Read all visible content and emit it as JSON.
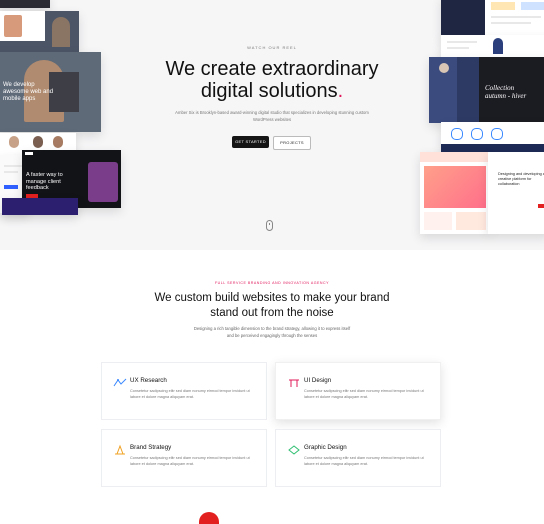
{
  "hero": {
    "eyebrow": "WATCH OUR REEL",
    "headline_line1": "We create extraordinary",
    "headline_line2": "digital solutions",
    "headline_dot": ".",
    "subtext": "Amber Six is Brooklyn-based award-winning digital studio that specializes in developing stunning custom WordPress websites",
    "primary_button": "GET STARTED",
    "secondary_button": "PROJECTS",
    "accent_color": "#e0185a"
  },
  "mockups": {
    "web_apps": "We develop awesome web and mobile apps",
    "client_feedback": "A faster way to manage client feedback",
    "collection": "Collection autumn - hiver",
    "collab": "Designing and developing a creative platform for collaboration"
  },
  "services": {
    "eyebrow": "FULL SERVICE BRANDING AND INNOVATION AGENCY",
    "title_line1": "We custom build websites to make your brand",
    "title_line2": "stand out from the noise",
    "subtitle": "Designing a rich tangible dimension to the brand strategy, allowing it to express itself and be perceived engagingly through the senses",
    "cards": [
      {
        "title": "UX Research",
        "icon": "ux-research-icon",
        "desc": "Consetetur sadipscing elitr sed diam nonumy eirmod tempor invidunt ut labore et dolore magna aliquyam erat."
      },
      {
        "title": "UI Design",
        "icon": "ui-design-icon",
        "desc": "Consetetur sadipscing elitr sed diam nonumy eirmod tempor invidunt ut labore et dolore magna aliquyam erat."
      },
      {
        "title": "Brand Strategy",
        "icon": "brand-strategy-icon",
        "desc": "Consetetur sadipscing elitr sed diam nonumy eirmod tempor invidunt ut labore et dolore magna aliquyam erat."
      },
      {
        "title": "Graphic Design",
        "icon": "graphic-design-icon",
        "desc": "Consetetur sadipscing elitr sed diam nonumy eirmod tempor invidunt ut labore et dolore magna aliquyam erat."
      }
    ]
  }
}
